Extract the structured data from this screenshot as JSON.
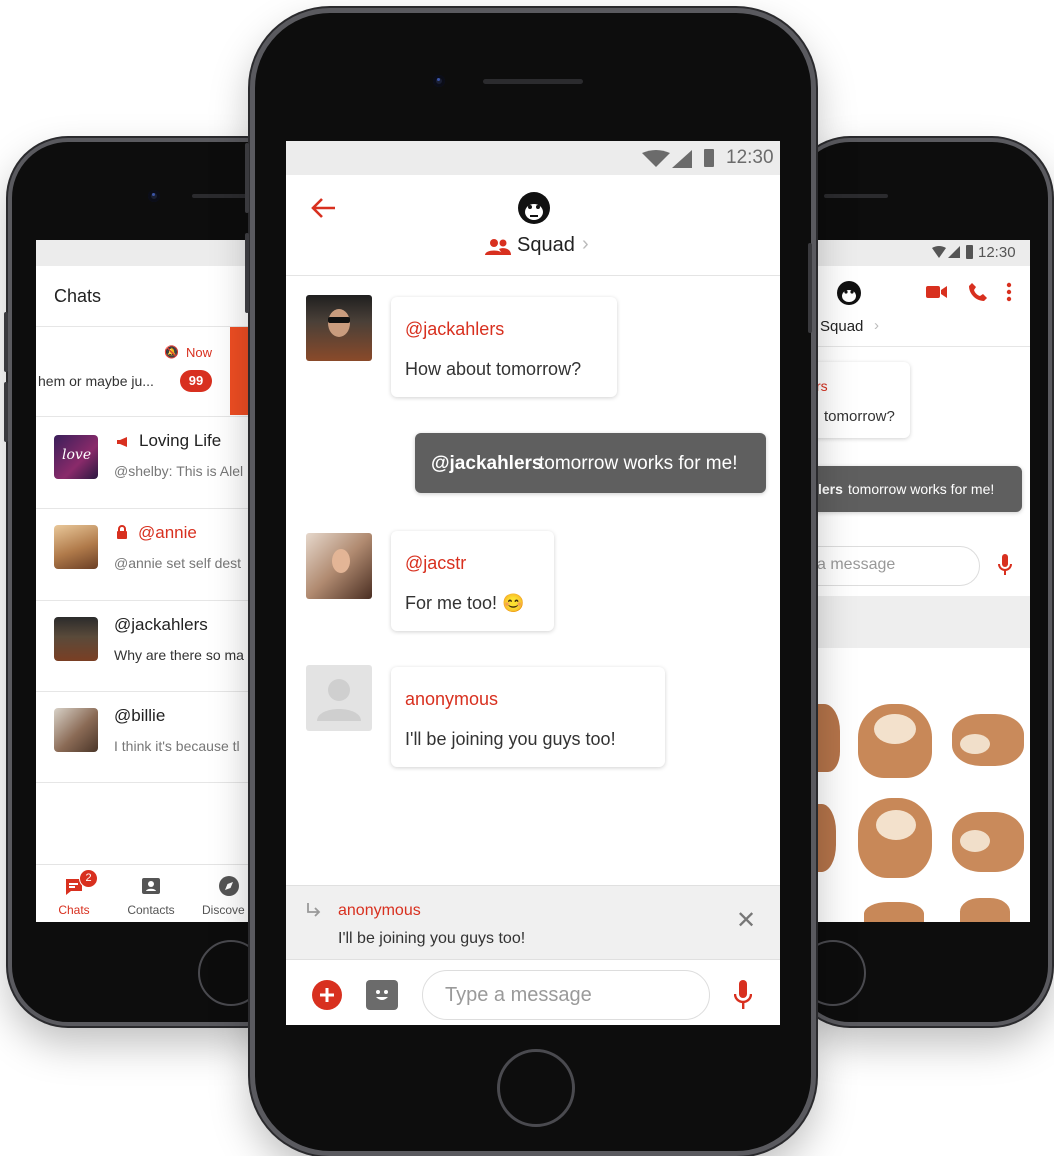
{
  "colors": {
    "accent": "#d8301f",
    "outgoing_bubble": "#5f5f5f",
    "status_bar": "#ececec"
  },
  "left_phone": {
    "header": {
      "title": "Chats"
    },
    "swiped_row": {
      "time": "Now",
      "preview": "hem or maybe ju...",
      "badge": "99"
    },
    "chats": [
      {
        "name": "Loving Life",
        "preview": "@shelby: This is Alel",
        "icon": "megaphone-icon"
      },
      {
        "name": "@annie",
        "preview": "@annie set self dest",
        "icon": "lock-icon"
      },
      {
        "name": "@jackahlers",
        "preview": "Why are there so ma"
      },
      {
        "name": "@billie",
        "preview": "I think it's because tl"
      }
    ],
    "avatar_caption": "love",
    "tabs": [
      {
        "label": "Chats",
        "badge": "2",
        "icon": "chat-icon"
      },
      {
        "label": "Contacts",
        "icon": "contact-card-icon"
      },
      {
        "label": "Discove",
        "icon": "compass-icon"
      }
    ]
  },
  "center_phone": {
    "status": {
      "time": "12:30"
    },
    "header": {
      "group_name": "Squad",
      "chevron": "›"
    },
    "messages": [
      {
        "sender": "@jackahlers",
        "text": "How about tomorrow?"
      },
      {
        "outgoing": true,
        "mention": "@jackahlers",
        "text": " tomorrow works for me!"
      },
      {
        "sender": "@jacstr",
        "text": "For me too! 😊"
      },
      {
        "sender": "anonymous",
        "text": "I'll be joining you guys too!"
      }
    ],
    "reply_preview": {
      "sender": "anonymous",
      "text": "I'll be joining you guys too!",
      "close": "✕"
    },
    "composer": {
      "placeholder": "Type a message"
    }
  },
  "right_phone": {
    "status": {
      "time": "12:30"
    },
    "header": {
      "group_name": "Squad",
      "chevron": "›"
    },
    "message_fragments": {
      "sender_tail": "rs",
      "text_tail": "tomorrow?",
      "outgoing_tail": "lers",
      "outgoing_rest": " tomorrow works for me!"
    },
    "composer": {
      "placeholder": "a message"
    }
  }
}
